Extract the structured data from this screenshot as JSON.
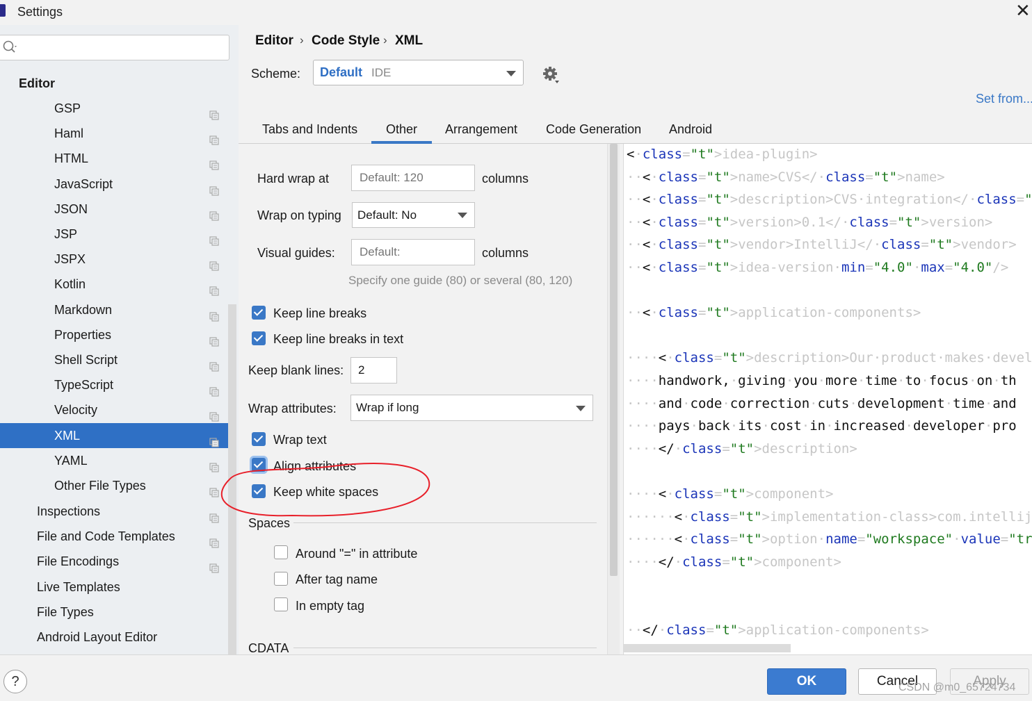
{
  "window": {
    "title": "Settings",
    "close_glyph": "✕"
  },
  "search": {
    "value": "",
    "placeholder": ""
  },
  "sidebar": {
    "section": "Editor",
    "items": [
      {
        "label": "GSP",
        "selected": false,
        "copy": true
      },
      {
        "label": "Haml",
        "selected": false,
        "copy": true
      },
      {
        "label": "HTML",
        "selected": false,
        "copy": true
      },
      {
        "label": "JavaScript",
        "selected": false,
        "copy": true
      },
      {
        "label": "JSON",
        "selected": false,
        "copy": true
      },
      {
        "label": "JSP",
        "selected": false,
        "copy": true
      },
      {
        "label": "JSPX",
        "selected": false,
        "copy": true
      },
      {
        "label": "Kotlin",
        "selected": false,
        "copy": true
      },
      {
        "label": "Markdown",
        "selected": false,
        "copy": true
      },
      {
        "label": "Properties",
        "selected": false,
        "copy": true
      },
      {
        "label": "Shell Script",
        "selected": false,
        "copy": true
      },
      {
        "label": "TypeScript",
        "selected": false,
        "copy": true
      },
      {
        "label": "Velocity",
        "selected": false,
        "copy": true
      },
      {
        "label": "XML",
        "selected": true,
        "copy": true
      },
      {
        "label": "YAML",
        "selected": false,
        "copy": true
      },
      {
        "label": "Other File Types",
        "selected": false,
        "copy": true
      }
    ],
    "top_items": [
      {
        "label": "Inspections",
        "copy": true
      },
      {
        "label": "File and Code Templates",
        "copy": true
      },
      {
        "label": "File Encodings",
        "copy": true
      },
      {
        "label": "Live Templates",
        "copy": false
      },
      {
        "label": "File Types",
        "copy": false
      },
      {
        "label": "Android Layout Editor",
        "copy": false
      }
    ]
  },
  "breadcrumb": {
    "items": [
      "Editor",
      "Code Style",
      "XML"
    ],
    "separator": "›"
  },
  "scheme": {
    "label": "Scheme:",
    "name": "Default",
    "tag": "IDE"
  },
  "set_from": "Set from...",
  "tabs": [
    "Tabs and Indents",
    "Other",
    "Arrangement",
    "Code Generation",
    "Android"
  ],
  "active_tab": "Other",
  "options": {
    "hard_wrap_label": "Hard wrap at",
    "hard_wrap_placeholder": "Default: 120",
    "columns_1": "columns",
    "wrap_typing_label": "Wrap on typing",
    "wrap_typing_value": "Default: No",
    "visual_guides_label": "Visual guides:",
    "visual_guides_placeholder": "Default:",
    "columns_2": "columns",
    "guide_hint": "Specify one guide (80) or several (80, 120)",
    "keep_line_breaks": "Keep line breaks",
    "keep_line_breaks_text": "Keep line breaks in text",
    "keep_blank_label": "Keep blank lines:",
    "keep_blank_value": "2",
    "wrap_attr_label": "Wrap attributes:",
    "wrap_attr_value": "Wrap if long",
    "wrap_text": "Wrap text",
    "align_attributes": "Align attributes",
    "keep_white_spaces": "Keep white spaces",
    "spaces_section": "Spaces",
    "around_eq": "Around \"=\" in attribute",
    "after_tag": "After tag name",
    "in_empty_tag": "In empty tag",
    "cdata_section": "CDATA"
  },
  "checkbox_states": {
    "keep_line_breaks": true,
    "keep_line_breaks_text": true,
    "wrap_text": true,
    "align_attributes": true,
    "keep_white_spaces": true,
    "around_eq": false,
    "after_tag": false,
    "in_empty_tag": false
  },
  "preview_lines": [
    "<idea-plugin>",
    "  <name>CVS</name>",
    "  <description>CVS integration</description>",
    "  <version>0.1</version>",
    "  <vendor>IntelliJ</vendor>",
    "  <idea-version min=\"4.0\" max=\"4.0\"/>",
    "",
    "  <application-components>",
    "",
    "    <description>Our product makes development a",
    "    handwork, giving you more time to focus on th",
    "    and code correction cuts development time and",
    "    pays back its cost in increased developer pro",
    "    </description>",
    "",
    "    <component>",
    "      <implementation-class>com.intellij.cvsSuppo",
    "      <option name=\"workspace\" value=\"true\"/>",
    "    </component>",
    "",
    "",
    "  </application-components>"
  ],
  "buttons": {
    "ok": "OK",
    "cancel": "Cancel",
    "apply": "Apply",
    "help": "?"
  },
  "watermark": "CSDN @m0_65724734",
  "colors": {
    "accent": "#3a78c6",
    "selection": "#2f70c5",
    "annotation": "#e8202a"
  }
}
